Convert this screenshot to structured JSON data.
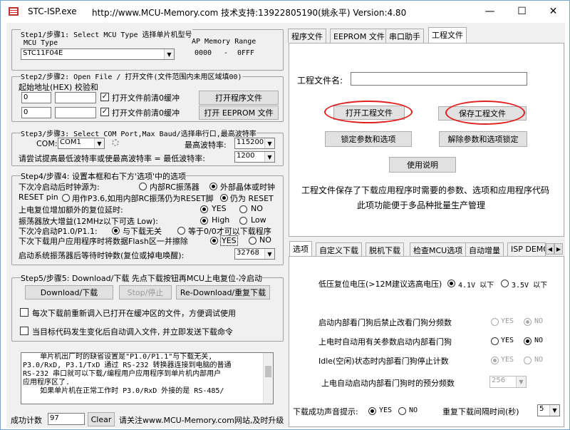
{
  "window": {
    "app_name": "STC-ISP.exe",
    "header_info": "http://www.MCU-Memory.com 技术支持:13922805190(姚永平) Version:4.80",
    "minimize": "—",
    "maximize": "☐",
    "close": "✕"
  },
  "step1": {
    "title": "Step1/步骤1: Select MCU Type  选择单片机型号",
    "mcu_type_label": "MCU Type",
    "mcu_value": "STC11F04E",
    "memory_range_label": "AP Memory Range",
    "range_start": "0000",
    "range_dash": "-",
    "range_end": "0FFF"
  },
  "step2": {
    "title": "Step2/步骤2: Open File / 打开文件(文件范围内未用区域填00)",
    "start_addr_label": "起始地址(HEX) 校验和",
    "row1_addr": "0",
    "row2_addr": "0",
    "check1_label": "打开文件前清0缓冲",
    "check2_label": "打开文件前清0缓冲",
    "open_prog_btn": "打开程序文件",
    "open_eeprom_btn": "打开 EEPROM 文件"
  },
  "step3": {
    "title": "Step3/步骤3: Select COM Port,Max Baud/选择串行口,最高波特率",
    "com_label": "COM:",
    "com_value": "COM1",
    "max_baud_label": "最高波特率:",
    "max_baud_value": "115200",
    "min_baud_label": "请尝试提高最低波特率或使最高波特率 =  最低波特率:",
    "min_baud_value": "1200"
  },
  "step4": {
    "title": "Step4/步骤4: 设置本框和右下方'选项'中的选项",
    "row1_label": "下次冷启动后时钟源为:",
    "row1_opt1": "内部RC振荡器",
    "row1_opt2": "外部晶体或时钟",
    "row2_label": "RESET pin",
    "row2_opt1": "用作P3.6,如用内部RC振荡仍为RESET脚",
    "row2_opt2": "仍为 RESET",
    "row3_label": "上电复位增加额外的复位延时:",
    "row3_opt1": "YES",
    "row3_opt2": "NO",
    "row4_label": "振荡器放大增益(12MHz以下可选 Low):",
    "row4_opt1": "High",
    "row4_opt2": "Low",
    "row5_label": "下次冷启动P1.0/P1.1:",
    "row5_opt1": "与下载无关",
    "row5_opt2": "等于0/0才可以下载程序",
    "row6_label": "下次下载用户应用程序时将数据Flash区一并擦除",
    "row6_opt1": "YES",
    "row6_opt2": "NO",
    "row7_label": "启动系统振荡器后等待时钟数(复位或掉电唤醒):",
    "row7_value": "32768"
  },
  "step5": {
    "title": "Step5/步骤5: Download/下载  先点下载按钮再MCU上电复位-冷启动",
    "download_btn": "Download/下载",
    "stop_btn": "Stop/停止",
    "redownload_btn": "Re-Download/重复下载",
    "check1_label": "每次下载前重新调入已打开在缓冲区的文件，方便调试使用",
    "check2_label": "当目标代码发生变化后自动调入文件, 并立即发送下载命令"
  },
  "message": {
    "lines": [
      "    单片机出厂时的缺省设置是\"P1.0/P1.1\"与下载无关,",
      "P3.0/RxD, P3.1/TxD 通过 RS-232 转换器连接到电脑的普通",
      "RS-232 串口就可以下载/编程用户应用程序到单片机内部用户",
      "应用程序区了.",
      "    如果单片机在正常工作时 P3.0/RxD 外接的是 RS-485/"
    ]
  },
  "status": {
    "count_label": "成功计数",
    "count_value": "97",
    "clear_btn": "Clear",
    "notice": "请关注www.MCU-Memory.com网站,及时升级"
  },
  "top_tabs": [
    "程序文件",
    "EEPROM 文件",
    "串口助手",
    "工程文件"
  ],
  "project": {
    "name_label": "工程文件名:",
    "name_value": "",
    "open_btn": "打开工程文件",
    "save_btn": "保存工程文件",
    "lock_btn": "锁定参数和选项",
    "unlock_btn": "解除参数和选项锁定",
    "help_btn": "使用说明",
    "desc_line1": "工程文件保存了下载应用程序时需要的参数、选项和应用程序代码",
    "desc_line2": "此项功能便于多品种批量生产管理"
  },
  "bottom_tabs": [
    "选项",
    "自定义下载",
    "脱机下载",
    "检查MCU选项",
    "自动增量",
    "ISP DEMO"
  ],
  "options": {
    "low_volt_label": "低压复位电压(>12M建议选高电压)",
    "low_volt_opt1": "4.1V 以下",
    "low_volt_opt2": "3.5V 以下",
    "wdt_stop_label": "启动内部看门狗后禁止改看门狗分频数",
    "wdt_poweron_label": "上电时自动用有关参数启动内部看门狗",
    "wdt_idle_label": "Idle(空闲)状态时内部看门狗停止计数",
    "wdt_prescale_label": "上电自动启动内部看门狗时的预分频数",
    "wdt_prescale_value": "256",
    "yes": "YES",
    "no": "NO",
    "dl_sound_label": "下载成功声音提示:",
    "dl_sound_yes": "YES",
    "dl_sound_no": "NO",
    "retry_label": "重复下载间隔时间(秒)",
    "retry_value": "5",
    "tab_scroll_left": "◀",
    "tab_scroll_right": "▶"
  }
}
